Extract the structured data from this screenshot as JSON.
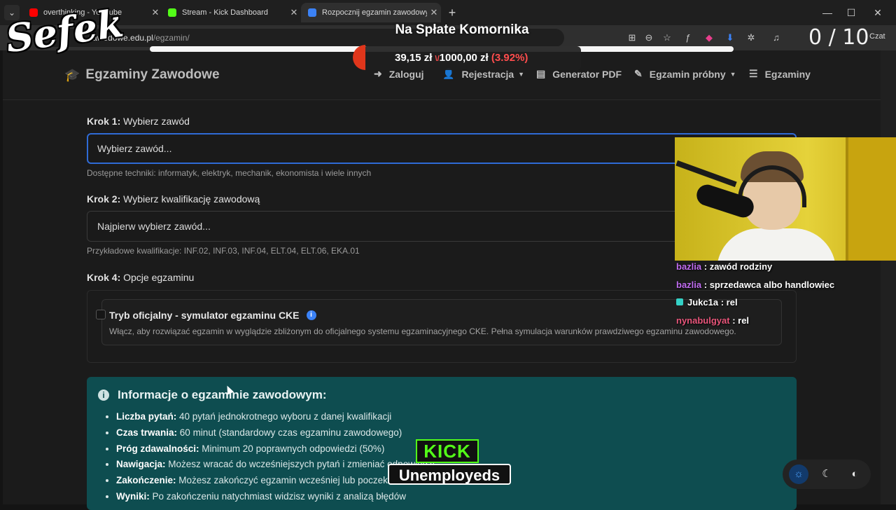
{
  "browser": {
    "tabs": [
      {
        "label": "overthinking - YouTube",
        "favicon_color": "#ff0000",
        "active": false
      },
      {
        "label": "Stream - Kick Dashboard",
        "favicon_color": "#53fc18",
        "active": false
      },
      {
        "label": "Rozpocznij egzamin zawodowy on",
        "favicon_color": "#3b82f6",
        "active": true
      }
    ],
    "tab_close": "✕",
    "new_tab": "+",
    "url_host": "zawodowe.edu.pl",
    "url_path": "/egzamin/",
    "chat_label": "Czat",
    "counter": "0 / 10",
    "win": {
      "min": "—",
      "max": "☐",
      "close": "✕"
    }
  },
  "overlay": {
    "logo": "Sefek",
    "title": "Na Spłate Komornika",
    "current": "39,15 zł",
    "arrow": "\\/",
    "goal": "1000,00 zł",
    "percent": "(3.92%)",
    "progress": 0.0392
  },
  "site": {
    "brand": "Egzaminy Zawodowe",
    "nav": [
      {
        "label": "Zaloguj",
        "icon": "sign-in-icon"
      },
      {
        "label": "Rejestracja",
        "icon": "user-plus-icon",
        "caret": true
      },
      {
        "label": "Generator PDF",
        "icon": "pdf-icon"
      },
      {
        "label": "Egzamin próbny",
        "icon": "edit-icon",
        "caret": true
      },
      {
        "label": "Egzaminy",
        "icon": "list-icon"
      }
    ],
    "step1": {
      "prefix": "Krok 1:",
      "label": "Wybierz zawód",
      "value": "Wybierz zawód...",
      "help": "Dostępne techniki: informatyk, elektryk, mechanik, ekonomista i wiele innych"
    },
    "step2": {
      "prefix": "Krok 2:",
      "label": "Wybierz kwalifikację zawodową",
      "value": "Najpierw wybierz zawód...",
      "help": "Przykładowe kwalifikacje: INF.02, INF.03, INF.04, ELT.04, ELT.06, EKA.01"
    },
    "step4": {
      "prefix": "Krok 4:",
      "label": "Opcje egzaminu"
    },
    "official": {
      "title": "Tryb oficjalny - symulator egzaminu CKE",
      "desc": "Włącz, aby rozwiązać egzamin w wyglądzie zbliżonym do oficjalnego systemu egzaminacyjnego CKE. Pełna symulacja warunków prawdziwego egzaminu zawodowego.",
      "checked": false
    },
    "info": {
      "title": "Informacje o egzaminie zawodowym:",
      "items": [
        {
          "k": "Liczba pytań:",
          "v": "40 pytań jednokrotnego wyboru z danej kwalifikacji"
        },
        {
          "k": "Czas trwania:",
          "v": "60 minut (standardowy czas egzaminu zawodowego)"
        },
        {
          "k": "Próg zdawalności:",
          "v": "Minimum 20 poprawnych odpowiedzi (50%)"
        },
        {
          "k": "Nawigacja:",
          "v": "Możesz wracać do wcześniejszych pytań i zmieniać odpowiedzi"
        },
        {
          "k": "Zakończenie:",
          "v": "Możesz zakończyć egzamin wcześniej lub poczekać"
        },
        {
          "k": "Wyniki:",
          "v": "Po zakończeniu natychmiast widzisz wyniki z analizą błędów"
        }
      ]
    }
  },
  "chat": [
    {
      "user": "bazlia",
      "color": "#c06cf0",
      "msg": "zawód rodziny"
    },
    {
      "user": "bazlia",
      "color": "#c06cf0",
      "msg": "sprzedawca albo handlowiec"
    },
    {
      "user": "Jukc1a",
      "color": "#ffffff",
      "msg": "rel",
      "badge": true
    },
    {
      "user": "nynabulgyat",
      "color": "#e8557a",
      "msg": "rel"
    }
  ],
  "kick": {
    "logo": "KICK",
    "tagline": "Unemployeds"
  }
}
